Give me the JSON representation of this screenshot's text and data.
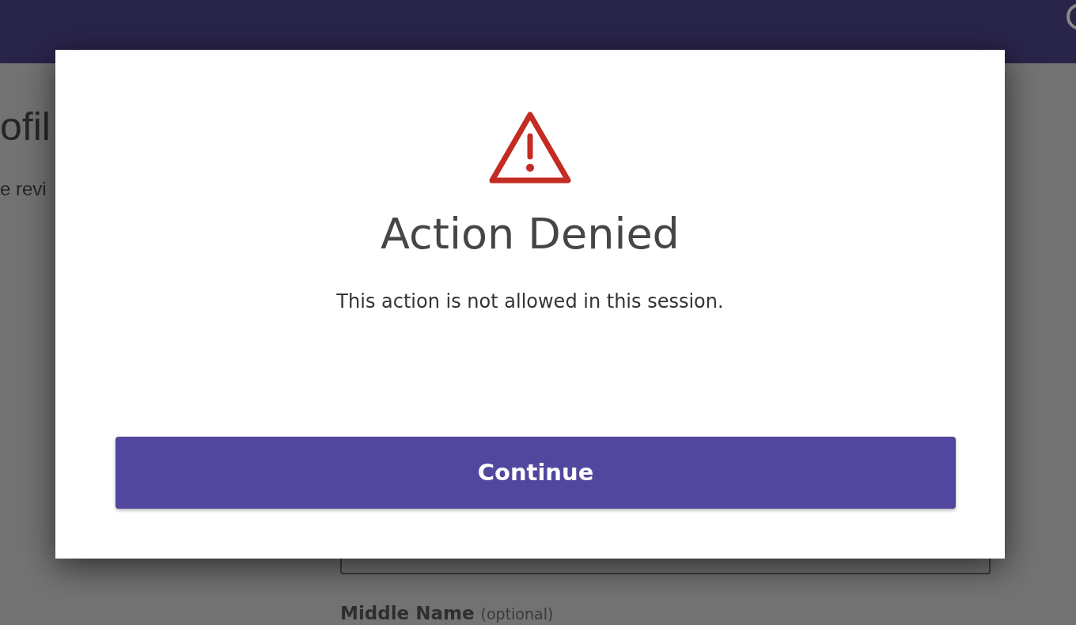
{
  "page": {
    "heading": "ofil",
    "subtitle": "e revi",
    "field_label": "Middle Name",
    "field_hint": "(optional)"
  },
  "dialog": {
    "title": "Action Denied",
    "message": "This action is not allowed in this session.",
    "button": "Continue"
  }
}
